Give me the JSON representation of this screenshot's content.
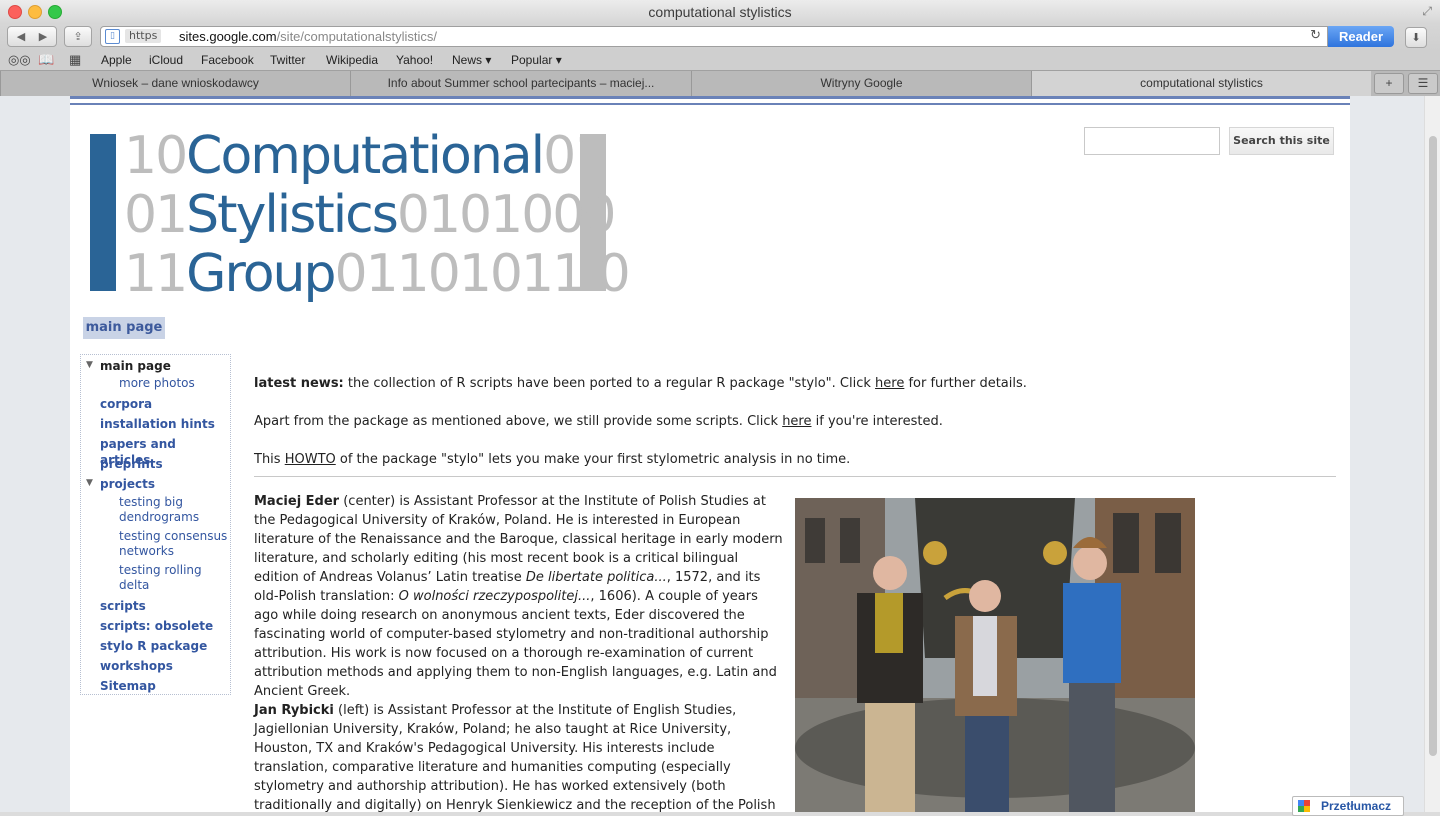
{
  "window": {
    "title": "computational stylistics"
  },
  "toolbar": {
    "back_glyph": "◀",
    "forward_glyph": "▶",
    "share_glyph": "⇪",
    "favicon_glyph": "▯",
    "https_label": "https",
    "url_host": "sites.google.com",
    "url_path": "/site/computationalstylistics/",
    "reload_glyph": "↻",
    "reader_label": "Reader",
    "download_glyph": "⬇"
  },
  "bookmarks": {
    "reading_list_glyph": "◎◎",
    "bookmarks_glyph": "📖",
    "top_sites_glyph": "▦",
    "items": [
      "Apple",
      "iCloud",
      "Facebook",
      "Twitter",
      "Wikipedia",
      "Yahoo!",
      "News ▾",
      "Popular ▾"
    ]
  },
  "tabs": {
    "items": [
      "Wniosek – dane wnioskodawcy",
      "Info about Summer school partecipants – maciej...",
      "Witryny Google",
      "computational stylistics"
    ],
    "add_glyph": "+",
    "list_glyph": "☰"
  },
  "logo": {
    "row1": {
      "pre": "10",
      "word": "Computational",
      "post": "01"
    },
    "row2": {
      "pre": "01",
      "word": "Stylistics",
      "post": "0101000"
    },
    "row3": {
      "pre": "11",
      "word": "Group",
      "post": "01101011 0"
    }
  },
  "search": {
    "button_label": "Search this site"
  },
  "page_tab": "main page",
  "sidebar": {
    "main_page": "main page",
    "more_photos": "more photos",
    "corpora": "corpora",
    "installation_hints": "installation hints",
    "papers_and_articles": "papers and articles",
    "preprints": "preprints",
    "projects": "projects",
    "testing_big_dendrograms": "testing big dendrograms",
    "testing_consensus_networks": "testing consensus networks",
    "testing_rolling_delta": "testing rolling delta",
    "scripts": "scripts",
    "scripts_obsolete": "scripts: obsolete",
    "stylo_r_package": "stylo R package",
    "workshops": "workshops",
    "sitemap": "Sitemap",
    "expand_glyph": "▼"
  },
  "news": {
    "p1_bold": "latest news:",
    "p1_text": " the collection of R scripts have been ported to a regular R package \"stylo\". Click ",
    "p1_link": "here",
    "p1_tail": " for further details.",
    "p2_text": "Apart from the package as mentioned above, we still provide some scripts. Click ",
    "p2_link": "here",
    "p2_tail": " if you're interested.",
    "p3_text": "This ",
    "p3_link": "HOWTO",
    "p3_tail": " of the package \"stylo\" lets you make your first stylometric analysis in no time."
  },
  "bio1": {
    "name": "Maciej Eder",
    "text1": " (center) is Assistant Professor at the Institute of Polish Studies at the Pedagogical University of Kraków, Poland. He is interested in European literature of the Renaissance and the Baroque, classical heritage in early modern literature, and scholarly editing (his most recent book is a critical bilingual edition of Andreas Volanus’ Latin treatise ",
    "italic1": "De libertate politica...",
    "text2": ", 1572, and its old-Polish translation: ",
    "italic2": "O wolności rzeczypospolitej...",
    "text3": ", 1606). A couple of years ago while doing research on anonymous ancient texts, Eder discovered the fascinating world of computer-based stylometry and non-traditional authorship attribution. His work is now focused on a thorough re-examination of current attribution methods and applying them to non-English languages, e.g. Latin and Ancient Greek."
  },
  "bio2": {
    "name": "Jan Rybicki",
    "text": " (left) is Assistant Professor at the Institute of English Studies, Jagiellonian University, Kraków, Poland; he also taught at Rice University, Houston, TX and Kraków's Pedagogical University. His interests include translation, comparative literature and humanities computing (especially stylometry and authorship attribution). He has worked extensively (both traditionally and digitally) on Henryk Sienkiewicz and the reception of the Polish novelist's works into English,"
  },
  "translate": {
    "label": "Przetłumacz"
  },
  "colors": {
    "brand_blue": "#2a6496",
    "logo_grey": "#bdbdbd",
    "link_blue": "#3356a0",
    "rule_blue": "#6a82b8"
  }
}
